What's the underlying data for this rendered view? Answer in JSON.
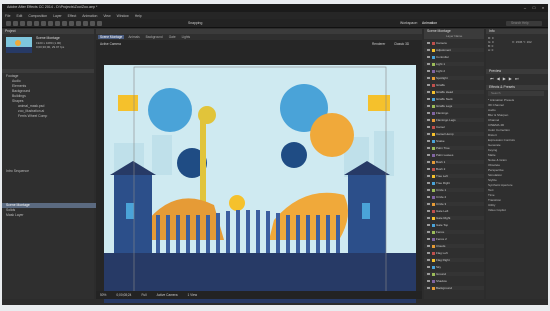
{
  "app_title": "Adobe After Effects CC 2014 - D:\\Projects\\Zoo\\Zoo.aep *",
  "menu": [
    "File",
    "Edit",
    "Composition",
    "Layer",
    "Effect",
    "Animation",
    "View",
    "Window",
    "Help"
  ],
  "toolbar": {
    "snapping": "Snapping",
    "workspace_label": "Workspace:",
    "workspace": "Animation",
    "search_placeholder": "Search Help"
  },
  "project": {
    "header": "Project",
    "comp_name": "Scene Montage",
    "comp_info": "1920 x 1080 (1.00)",
    "comp_duration": "0;00;30;00, 29.97 fps",
    "items": [
      "Footage",
      "Audio",
      "Elements",
      "Background",
      "Buildings",
      "Shapes",
      "animal_mask.psd",
      "zoo_illustration.ai",
      "Ferris Wheel Comp",
      "Intro Sequence",
      "Scene Montage",
      "Solids",
      "Mask Layer"
    ]
  },
  "comp_tabs": [
    "Scene Montage",
    "Animals",
    "Background",
    "Gate",
    "Lights"
  ],
  "viewer": {
    "camera_label": "Active Camera",
    "renderer_label": "Renderer",
    "renderer": "Classic 3D",
    "zoom": "50%",
    "timecode": "0;00;08;24",
    "resolution": "Full",
    "view": "Active Camera",
    "views": "1 View"
  },
  "timeline": {
    "header": "Scene Montage",
    "col_label": "Layer Name",
    "layers": [
      "Camera",
      "Adjustment",
      "Controller",
      "Light 1",
      "Light 2",
      "Spotlight",
      "Giraffe",
      "Giraffe Head",
      "Giraffe Neck",
      "Giraffe Legs",
      "Flamingo",
      "Flamingo Legs",
      "Camel",
      "Camel Hump",
      "Snake",
      "Palm Tree",
      "Palm Leaves",
      "Bush 1",
      "Bush 2",
      "Tree Left",
      "Tree Right",
      "Circle 1",
      "Circle 2",
      "Circle 3",
      "Gate Left",
      "Gate Right",
      "Gate Top",
      "Fence",
      "Fence 2",
      "Clouds",
      "Flag Left",
      "Flag Right",
      "Sky",
      "Ground",
      "Shadow",
      "Background"
    ]
  },
  "right_panel": {
    "info_header": "Info",
    "info_values": [
      "R: 0",
      "G: 0",
      "B: 0",
      "A: 0"
    ],
    "info_coords": "X: 1536  Y: 162",
    "preview_header": "Preview",
    "effects_header": "Effects & Presets",
    "effects_search": "Search",
    "effects": [
      "* Animation Presets",
      "3D Channel",
      "Audio",
      "Blur & Sharpen",
      "Channel",
      "CINEMA 4D",
      "Color Correction",
      "Distort",
      "Expression Controls",
      "Generate",
      "Keying",
      "Matte",
      "Noise & Grain",
      "Obsolete",
      "Perspective",
      "Simulation",
      "Stylize",
      "Synthetic Aperture",
      "Text",
      "Time",
      "Transition",
      "Utility",
      "Video Copilot"
    ]
  },
  "colors": {
    "bg": "#2c2c2c",
    "panel": "#2f2f2f",
    "sky": "#cfeaf1",
    "navy": "#273a66",
    "accent": "#f5c12c",
    "orange": "#e69b36",
    "blue": "#4aa3d8"
  }
}
